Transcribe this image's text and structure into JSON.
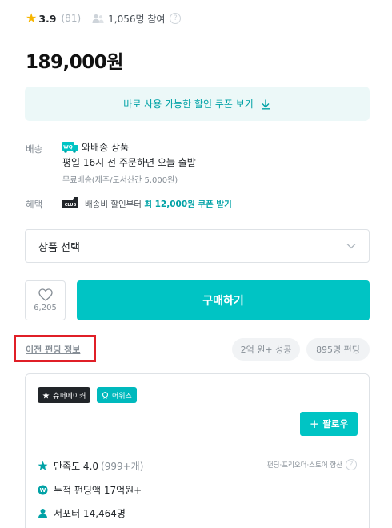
{
  "rating": {
    "score": "3.9",
    "count": "(81)",
    "participants": "1,056명 참여"
  },
  "price": "189,000원",
  "coupon": {
    "label": "바로 사용 가능한 할인 쿠폰 보기"
  },
  "shipping": {
    "label": "배송",
    "type": "와배송 상품",
    "promise": "평일 16시 전 주문하면 오늘 출발",
    "fee": "무료배송(제주/도서산간 5,000원)"
  },
  "benefit": {
    "label": "혜택",
    "prefix": "배송비 할인부터",
    "highlight": "최 12,000원 쿠폰 받기"
  },
  "option": {
    "placeholder": "상품 선택"
  },
  "like": {
    "count": "6,205"
  },
  "buy": {
    "label": "구매하기"
  },
  "history": {
    "link": "이전 펀딩 정보",
    "pills": [
      "2억 원+ 성공",
      "895명 펀딩"
    ]
  },
  "maker": {
    "tags": [
      "슈퍼메이커",
      "어워즈"
    ],
    "follow": "팔로우",
    "store_note": "펀딩·프리오더·스토어 합산",
    "stats": [
      {
        "label": "만족도 4.0",
        "sub": "(999+개)"
      },
      {
        "label": "누적 펀딩액 17억원+",
        "sub": ""
      },
      {
        "label": "서포터 14,464명",
        "sub": ""
      }
    ]
  },
  "colors": {
    "accent": "#00c4c4",
    "accent_text": "#00a2a6",
    "star": "#f7b500",
    "highlight_box": "#e01f27"
  },
  "icons": [
    "star-icon",
    "people-icon",
    "help-icon",
    "download-icon",
    "truck-icon",
    "club-icon",
    "chevron-down-icon",
    "heart-icon",
    "crown-icon",
    "award-icon",
    "plus-icon",
    "wallet-icon",
    "user-icon"
  ]
}
